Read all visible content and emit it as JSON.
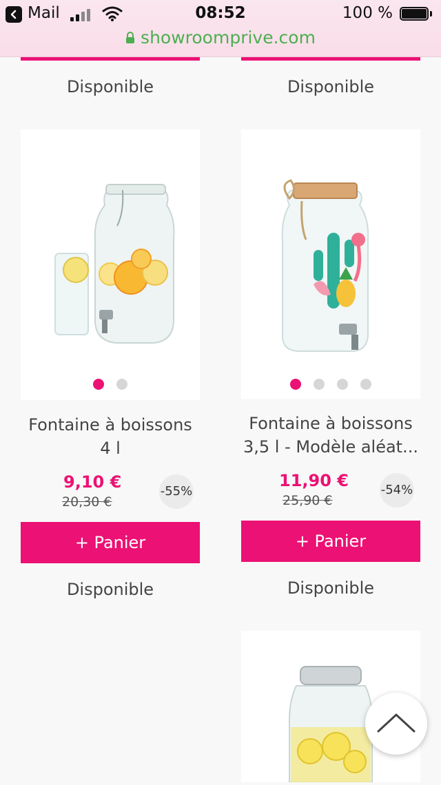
{
  "status_bar": {
    "back_app": "Mail",
    "time": "08:52",
    "battery": "100 %"
  },
  "browser": {
    "url": "showroomprive.com"
  },
  "top_row": {
    "left_availability": "Disponible",
    "right_availability": "Disponible"
  },
  "products": [
    {
      "title_line1": "Fontaine à boissons",
      "title_line2": "4 l",
      "price": "9,10 €",
      "old_price": "20,30 €",
      "discount": "-55%",
      "add_label": "+ Panier",
      "availability": "Disponible",
      "image_dots": 2,
      "active_dot": 1
    },
    {
      "title_line1": "Fontaine à boissons",
      "title_line2": "3,5 l - Modèle aléat...",
      "price": "11,90 €",
      "old_price": "25,90 €",
      "discount": "-54%",
      "add_label": "+ Panier",
      "availability": "Disponible",
      "image_dots": 4,
      "active_dot": 1
    }
  ],
  "colors": {
    "accent": "#ec1174",
    "url_green": "#4caf50"
  },
  "icons": {
    "scroll_top": "chevron-up-icon"
  }
}
